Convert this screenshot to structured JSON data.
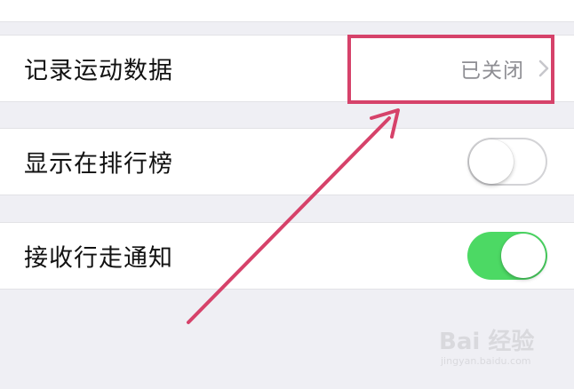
{
  "settings": {
    "rows": [
      {
        "label": "记录运动数据",
        "value": "已关闭",
        "control": "disclosure"
      },
      {
        "label": "显示在排行榜",
        "control": "toggle",
        "state": "off"
      },
      {
        "label": "接收行走通知",
        "control": "toggle",
        "state": "on"
      }
    ]
  },
  "annotation": {
    "color": "#d6426a",
    "icons": [
      "highlight-box",
      "arrow-icon"
    ]
  },
  "watermark": {
    "brand": "Bai 经验",
    "url": "jingyan.baidu.com"
  },
  "colors": {
    "toggle_on": "#4cd964",
    "toggle_off": "#d3d3d6",
    "background": "#efeff4"
  }
}
